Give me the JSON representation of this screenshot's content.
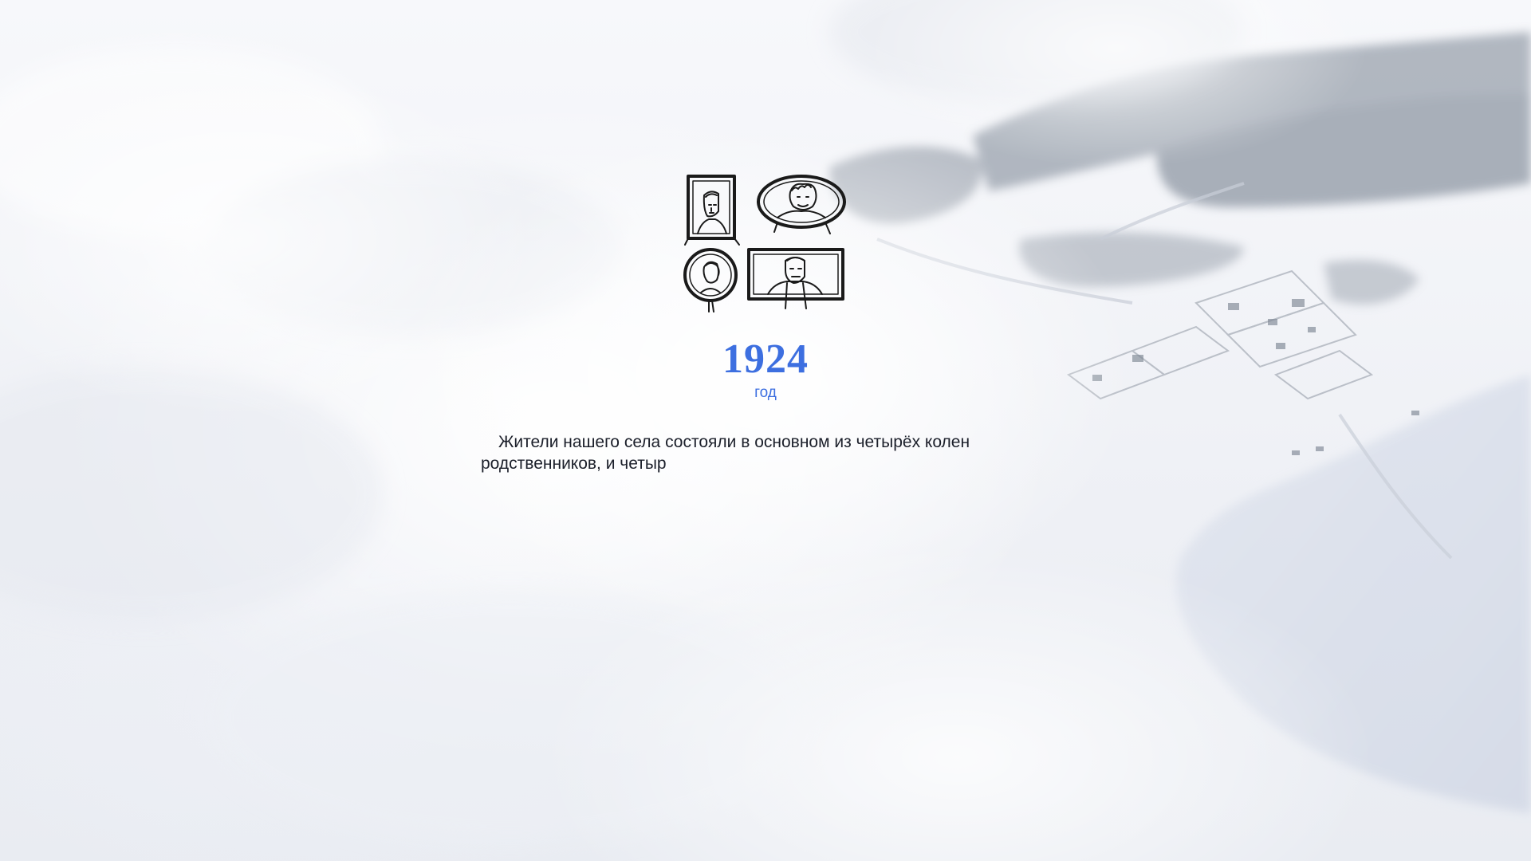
{
  "intro": {
    "year": "1924",
    "year_unit": "год",
    "text": "Жители нашего села состояли в основном из четырёх колен родственников, и четыр"
  },
  "icons": {
    "portraits": "family-portraits-icon"
  },
  "colors": {
    "accent": "#3d6fe0",
    "text": "#1b1f2a",
    "ink": "#1a1a1a"
  }
}
